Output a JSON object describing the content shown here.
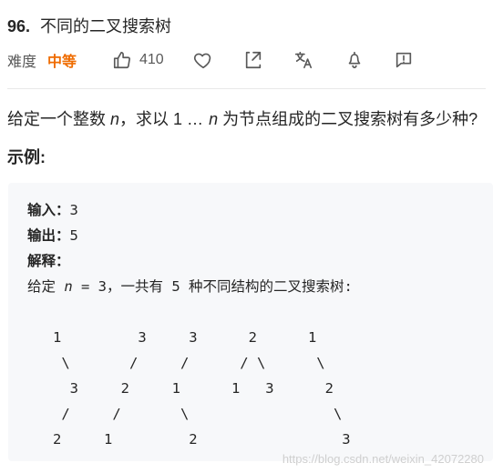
{
  "header": {
    "problem_number": "96.",
    "problem_title": "不同的二叉搜索树",
    "difficulty_label": "难度",
    "difficulty_value": "中等",
    "like_count": "410"
  },
  "icons": {
    "like": "thumbs-up-icon",
    "favorite": "heart-icon",
    "share": "share-icon",
    "translate": "translate-icon",
    "notify": "bell-icon",
    "feedback": "message-icon"
  },
  "colors": {
    "accent": "#ef6c00",
    "divider": "#e8e8e8",
    "code_bg": "#f7f8fa"
  },
  "content": {
    "description": {
      "prefix": "给定一个整数 ",
      "n1": "n",
      "mid": "，求以 1 ",
      "ellipsis": "…",
      "space": " ",
      "n2": "n",
      "suffix": " 为节点组成的二叉搜索树有多少种?"
    },
    "example_label": "示例:",
    "example": {
      "input_label": "输入：",
      "input_value": "3",
      "output_label": "输出：",
      "output_value": "5",
      "explain_label": "解释：",
      "explain_prefix": "给定 ",
      "explain_n": "n",
      "explain_suffix": " = 3，一共有 5 种不同结构的二叉搜索树:",
      "tree_lines": [
        "",
        "   1         3     3      2      1",
        "    \\       /     /      / \\      \\",
        "     3     2     1      1   3      2",
        "    /     /       \\                 \\",
        "   2     1         2                 3"
      ]
    }
  },
  "watermark": "https://blog.csdn.net/weixin_42072280"
}
